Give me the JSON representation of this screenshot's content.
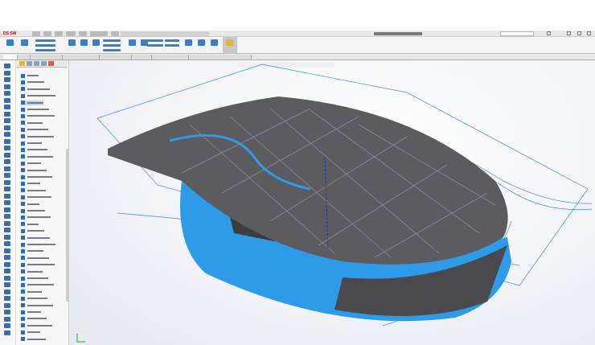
{
  "app": {
    "logo_text": "SOLIDWORKS",
    "brand_color": "#cc0000"
  },
  "model": {
    "top_color": "#555558",
    "side_color": "#2e9be8",
    "curve_color": "#3d8ee0"
  },
  "icons": [
    "save-icon",
    "open-icon",
    "rebuild-icon",
    "options-icon",
    "search-icon",
    "help-icon",
    "minimize-icon",
    "maximize-icon",
    "close-icon"
  ]
}
